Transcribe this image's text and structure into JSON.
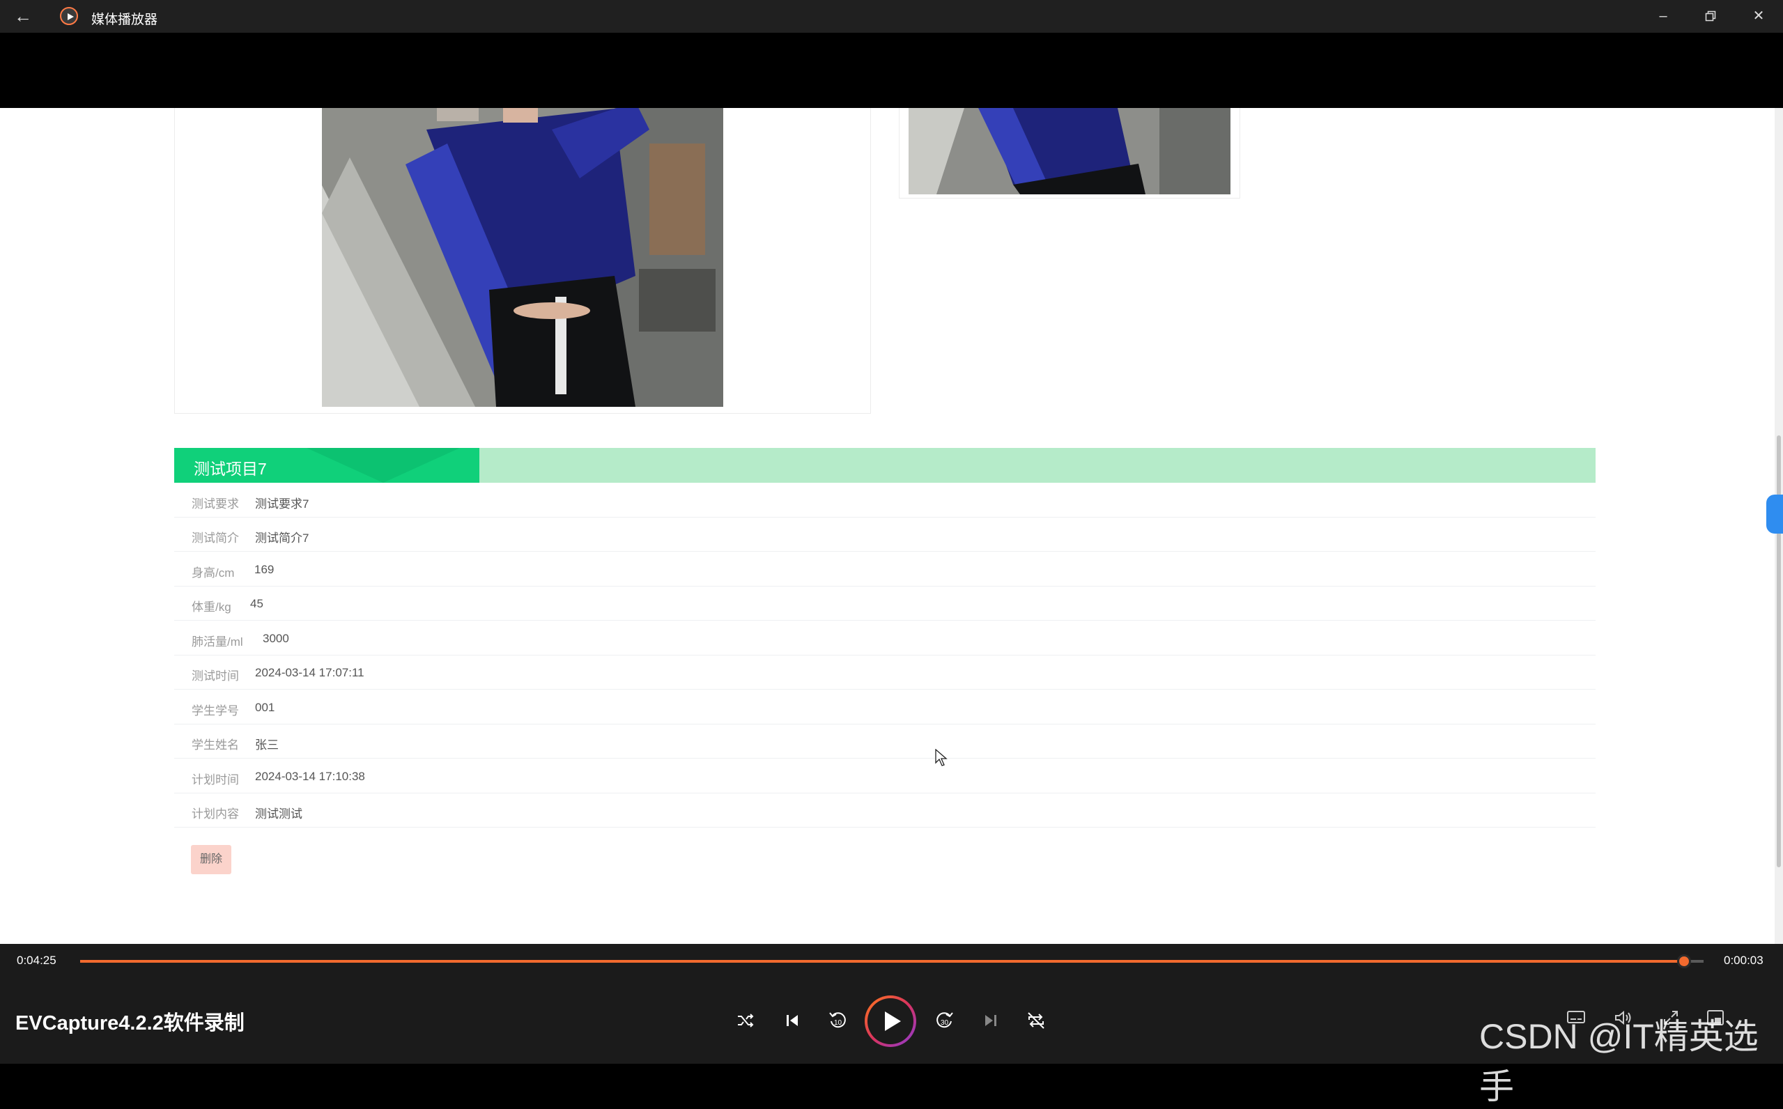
{
  "app": {
    "title": "媒体播放器"
  },
  "section": {
    "title": "测试项目7"
  },
  "details": [
    {
      "label": "测试要求",
      "value": "测试要求7"
    },
    {
      "label": "测试简介",
      "value": "测试简介7"
    },
    {
      "label": "身高/cm",
      "value": "169"
    },
    {
      "label": "体重/kg",
      "value": "45"
    },
    {
      "label": "肺活量/ml",
      "value": "3000"
    },
    {
      "label": "测试时间",
      "value": "2024-03-14 17:07:11"
    },
    {
      "label": "学生学号",
      "value": "001"
    },
    {
      "label": "学生姓名",
      "value": "张三"
    },
    {
      "label": "计划时间",
      "value": "2024-03-14 17:10:38"
    },
    {
      "label": "计划内容",
      "value": "测试测试"
    }
  ],
  "actions": {
    "delete_label": "删除"
  },
  "player": {
    "elapsed": "0:04:25",
    "remaining": "0:00:03",
    "progress": 0.988,
    "media_title": "EVCapture4.2.2软件录制",
    "accent_color": "#f26a2e"
  },
  "watermark": "CSDN @IT精英选手",
  "icons": [
    "back-arrow-icon",
    "media-player-icon",
    "minimize-icon",
    "restore-icon",
    "close-icon",
    "shuffle-icon",
    "previous-icon",
    "rewind-10-icon",
    "play-icon",
    "forward-30-icon",
    "next-icon",
    "repeat-off-icon",
    "subtitles-icon",
    "volume-icon",
    "fullscreen-icon",
    "mini-view-icon"
  ]
}
